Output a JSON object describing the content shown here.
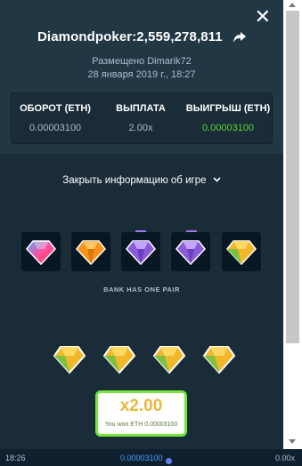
{
  "header": {
    "title": "Diamondpoker:2,559,278,811",
    "placed_by": "Размещено Dimarik72",
    "date": "28 января 2019 г., 18:27"
  },
  "stats": {
    "turnover_label": "ОБОРОТ (ETH)",
    "turnover_value": "0.00003100",
    "payout_label": "ВЫПЛАТА",
    "payout_value": "2.00x",
    "win_label": "ВЫИГРЫШ (ETH)",
    "win_value": "0.00003100"
  },
  "toggle_label": "Закрыть информацию об игре",
  "bank": {
    "gems": [
      "rainbow",
      "orange",
      "purple",
      "purple",
      "yellow-green"
    ],
    "result_label": "BANK HAS ONE PAIR"
  },
  "player": {
    "gems": [
      "yellow-green",
      "yellow-green",
      "yellow-green",
      "yellow-green"
    ]
  },
  "payout_box": {
    "multiplier": "x2.00",
    "won_text": "You won ETH 0.00003100"
  },
  "footer": {
    "time": "18:26",
    "amount": "0.00003100",
    "multiplier": "0.00x"
  },
  "colors": {
    "win_green": "#5bd133",
    "accent_purple": "#9b7bea",
    "payout_border": "#73e83b"
  }
}
